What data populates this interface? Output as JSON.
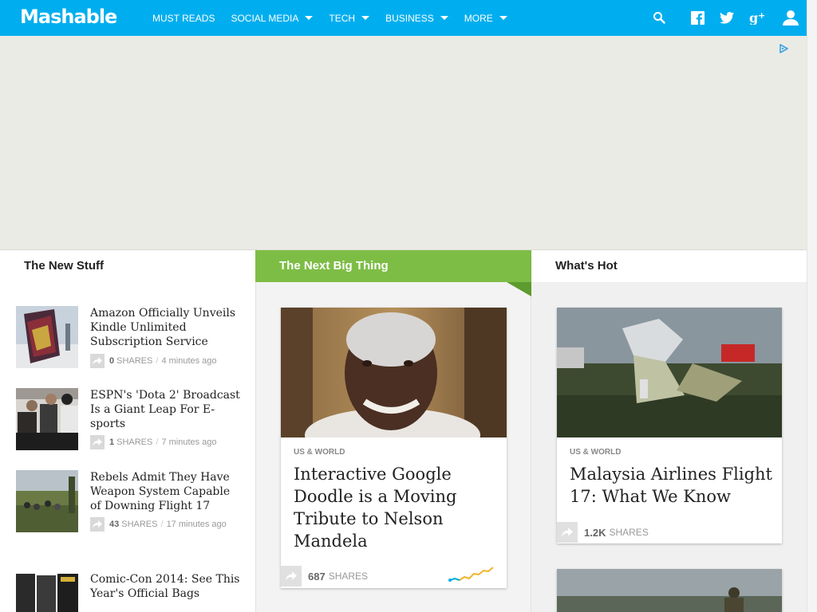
{
  "header": {
    "logo": "Mashable",
    "nav": [
      "MUST READS",
      "SOCIAL MEDIA",
      "TECH",
      "BUSINESS",
      "MORE"
    ],
    "brand_color": "#00aeef"
  },
  "columns": {
    "new_stuff": "The New Stuff",
    "next_big_thing": "The Next Big Thing",
    "whats_hot": "What's Hot"
  },
  "new_stuff_items": [
    {
      "title": "Amazon Officially Unveils Kindle Unlimited Subscription Service",
      "shares": "0",
      "shares_label": "SHARES",
      "time": "4 minutes ago"
    },
    {
      "title": "ESPN's 'Dota 2' Broadcast Is a Giant Leap For E-sports",
      "shares": "1",
      "shares_label": "SHARES",
      "time": "7 minutes ago"
    },
    {
      "title": "Rebels Admit They Have Weapon System Capable of Downing Flight 17",
      "shares": "43",
      "shares_label": "SHARES",
      "time": "17 minutes ago"
    },
    {
      "title": "Comic-Con 2014: See This Year's Official Bags"
    }
  ],
  "next_big_thing_card": {
    "category": "US & WORLD",
    "title": "Interactive Google Doodle is a Moving Tribute to Nelson Mandela",
    "shares": "687",
    "shares_label": "SHARES"
  },
  "whats_hot_card": {
    "category": "US & WORLD",
    "title": "Malaysia Airlines Flight 17: What We Know",
    "shares": "1.2K",
    "shares_label": "SHARES"
  },
  "icons": [
    "search-icon",
    "facebook-icon",
    "twitter-icon",
    "google-plus-icon",
    "user-icon",
    "adchoices-icon",
    "share-arrow-icon",
    "trend-sparkline-icon"
  ]
}
